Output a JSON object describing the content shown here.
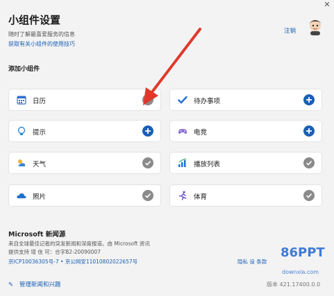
{
  "header": {
    "title": "小组件设置",
    "subtitle": "随时了解最喜爱服务的信息",
    "tips_link": "获取有关小组件的使用技巧",
    "sign_out": "注销",
    "close_glyph": "✕"
  },
  "widgets_section": {
    "heading": "添加小组件",
    "items": [
      {
        "label": "日历",
        "icon": "calendar-icon",
        "state": "added"
      },
      {
        "label": "待办事项",
        "icon": "check-icon",
        "state": "add"
      },
      {
        "label": "提示",
        "icon": "tips-icon",
        "state": "add"
      },
      {
        "label": "电竞",
        "icon": "gamepad-icon",
        "state": "add"
      },
      {
        "label": "天气",
        "icon": "weather-icon",
        "state": "added"
      },
      {
        "label": "播放列表",
        "icon": "playlist-icon",
        "state": "added"
      },
      {
        "label": "照片",
        "icon": "cloud-icon",
        "state": "added"
      },
      {
        "label": "体育",
        "icon": "sports-icon",
        "state": "added"
      }
    ]
  },
  "news": {
    "title": "Microsoft 新闻源",
    "description": "来自全球最佳记者的突发新闻和深度报道。由 Microsoft 资讯",
    "provider": "提供支持 增 信 可：合字B2-20090007",
    "icp": "京ICP10036305号-7  •  京公网安11010802022657号",
    "manage": "管理新闻和兴趣",
    "policy": "隐私 设 条款",
    "version": "版本 421.17400.0.0"
  },
  "watermark": {
    "brand": "86PPT",
    "sub": "downxia.com"
  },
  "colors": {
    "accent": "#1a5fb4",
    "added_state": "#8a8a8a",
    "annotation_arrow": "#e0392b"
  }
}
